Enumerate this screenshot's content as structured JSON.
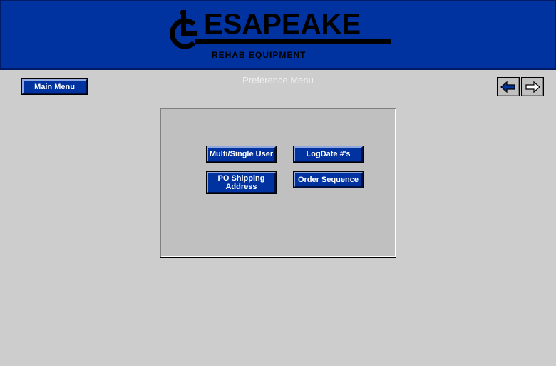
{
  "brand": {
    "wordmark": "ESAPEAKE",
    "subtitle": "REHAB EQUIPMENT",
    "emblem_icon": "wheelchair-c-logo"
  },
  "toolbar": {
    "main_menu_label": "Main Menu",
    "back_icon": "arrow-left-icon",
    "forward_icon": "arrow-right-icon"
  },
  "page": {
    "title": "Preference Menu"
  },
  "menu": {
    "multi_single_user": "Multi/Single User",
    "logdate": "LogDate #'s",
    "po_shipping_address": "PO Shipping Address",
    "order_sequence": "Order Sequence"
  },
  "colors": {
    "header_bg": "#0033a0",
    "button_bg": "#0033a0",
    "page_bg": "#cdcdcd"
  }
}
